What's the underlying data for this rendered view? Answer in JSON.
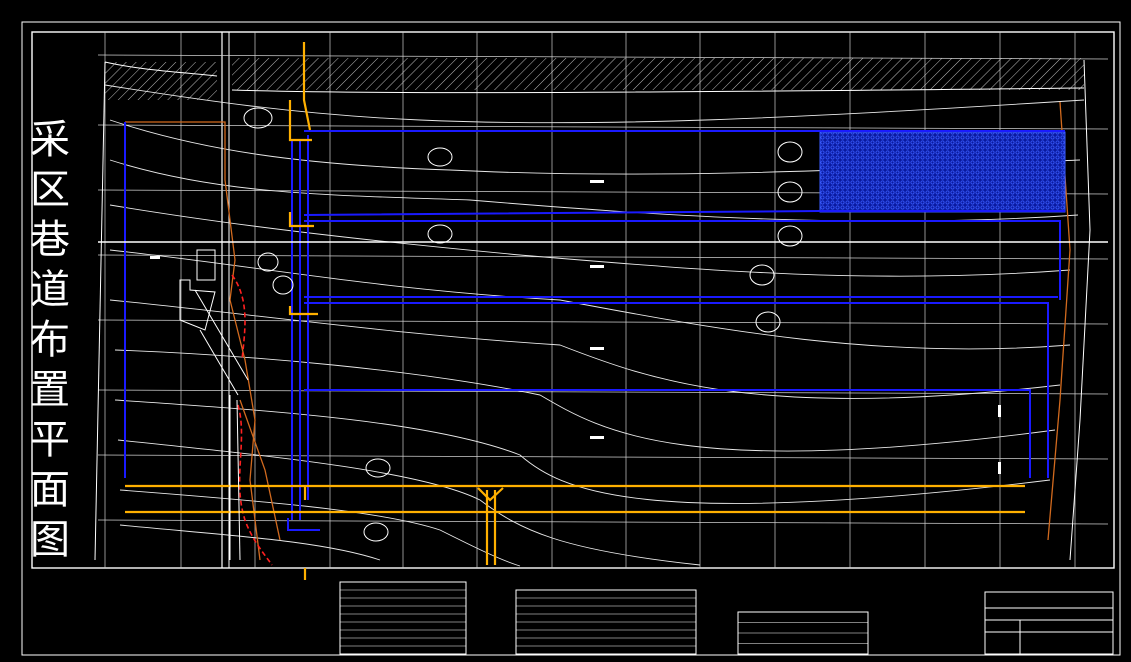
{
  "drawing": {
    "title_chars": [
      "采",
      "区",
      "巷",
      "道",
      "布",
      "置",
      "平",
      "面",
      "图"
    ]
  },
  "colors": {
    "background": "#000000",
    "frame": "#ffffff",
    "roadway": "#1a1aff",
    "roadway_dark": "#0000c8",
    "haulage": "#ffb000",
    "boundary": "#d26a1e",
    "fault": "#ff2020",
    "goaf_fill": "#1030ff"
  }
}
